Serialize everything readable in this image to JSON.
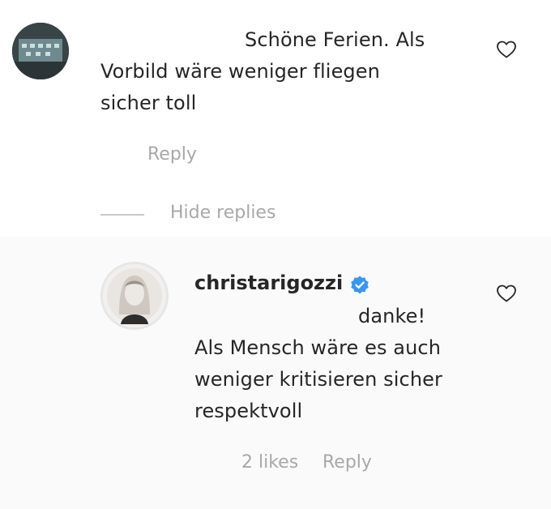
{
  "top_comment": {
    "line1": "Schöne Ferien. Als",
    "line2": "Vorbild wäre weniger fliegen",
    "line3": "sicher toll",
    "reply_label": "Reply"
  },
  "thread": {
    "hide_replies_label": "Hide replies"
  },
  "reply_comment": {
    "username": "christarigozzi",
    "line1": "danke!",
    "line2": "Als Mensch wäre es auch",
    "line3": "weniger kritisieren sicher",
    "line4": "respektvoll",
    "likes_label": "2 likes",
    "reply_label": "Reply"
  },
  "colors": {
    "text": "#262626",
    "muted": "#a8a8a8",
    "verified": "#3897f0",
    "reply_background": "#fafafa"
  },
  "icons": {
    "like": "heart-outline-icon",
    "verified": "verified-badge-icon"
  }
}
